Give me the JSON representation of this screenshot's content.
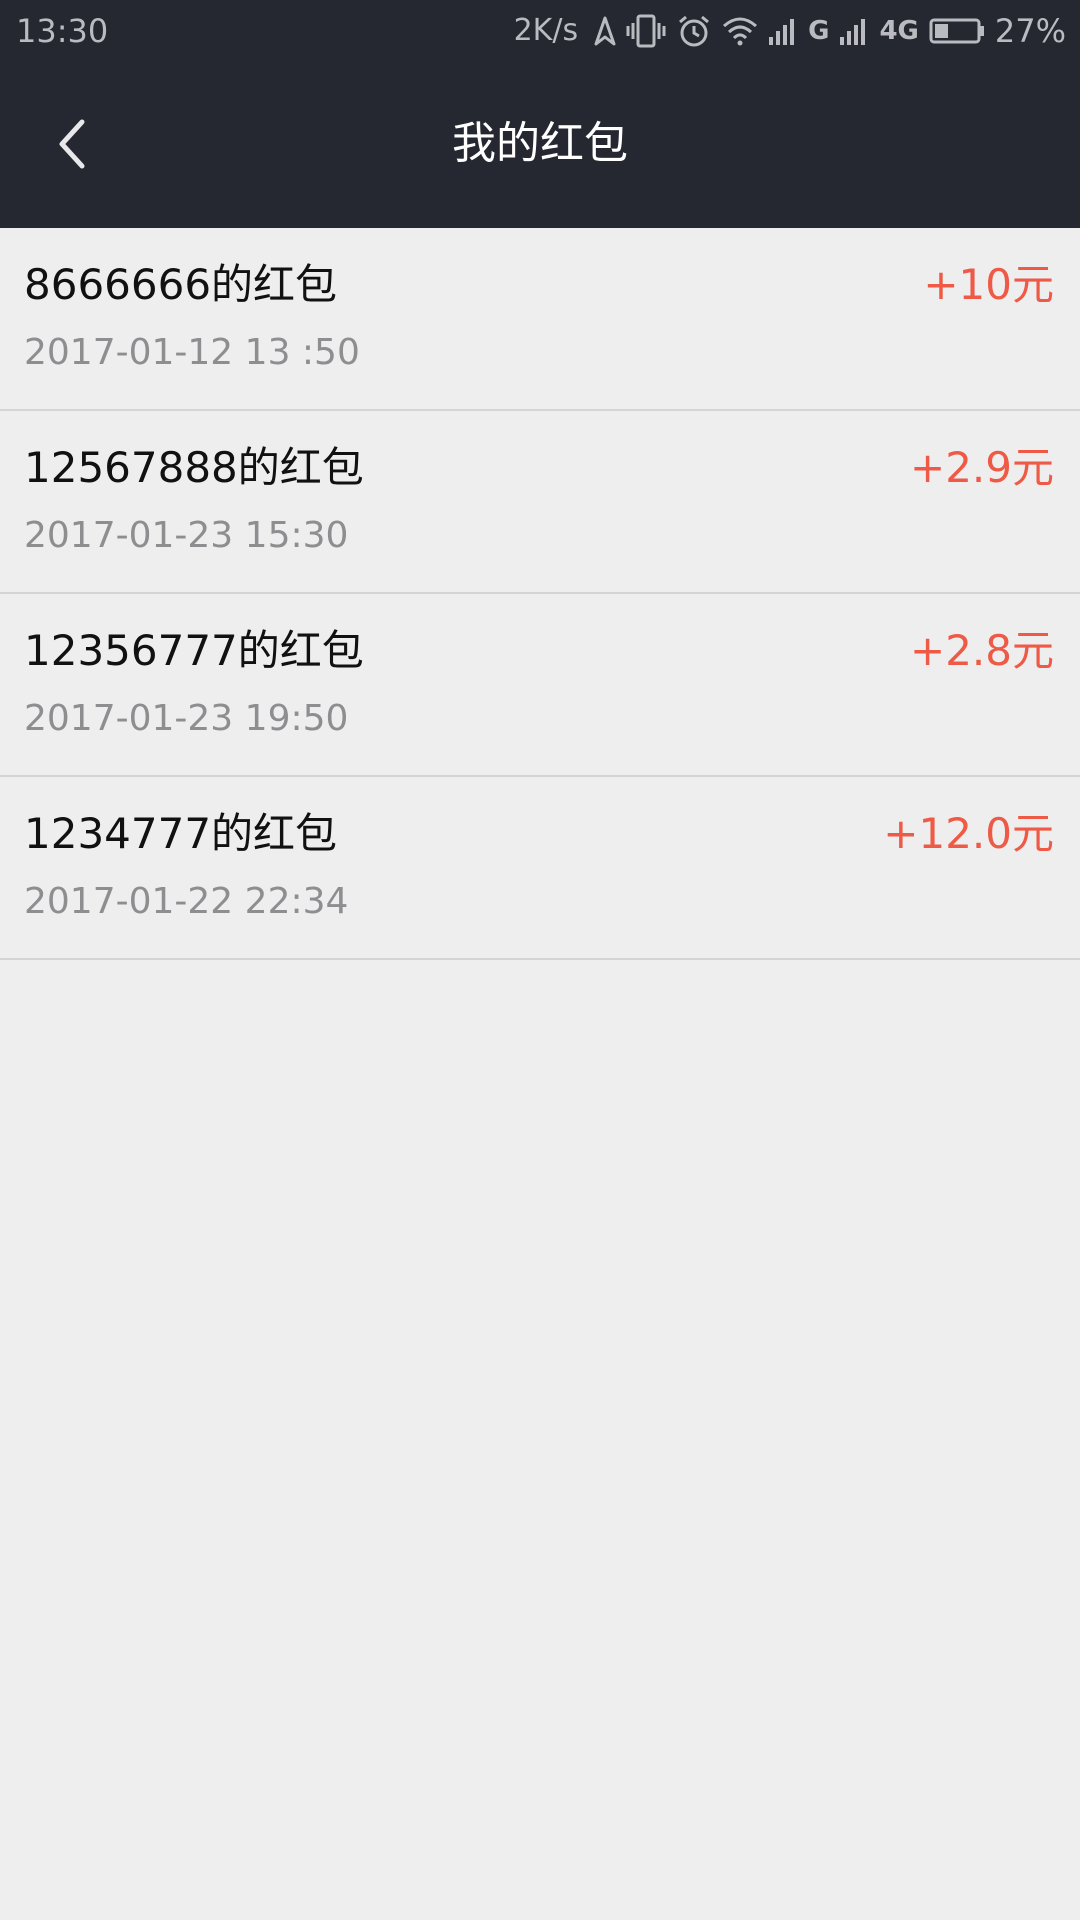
{
  "status_bar": {
    "time": "13:30",
    "net_speed": "2K/s",
    "sim1_label": "G",
    "sim2_label": "4G",
    "battery": "27%",
    "icons": [
      "navigation-icon",
      "vibrate-icon",
      "alarm-icon",
      "wifi-icon",
      "signal-icon",
      "signal-icon",
      "battery-icon"
    ]
  },
  "header": {
    "title": "我的红包",
    "back_icon": "chevron-left-icon"
  },
  "colors": {
    "header_bg": "#252830",
    "page_bg": "#eeeeef",
    "amount": "#ee5a45",
    "secondary_text": "#8e8e91"
  },
  "red_packets": [
    {
      "title": "8666666的红包",
      "time": "2017-01-12 13 :50",
      "amount": "+10元"
    },
    {
      "title": "12567888的红包",
      "time": "2017-01-23 15:30",
      "amount": "+2.9元"
    },
    {
      "title": "12356777的红包",
      "time": "2017-01-23 19:50",
      "amount": "+2.8元"
    },
    {
      "title": "1234777的红包",
      "time": "2017-01-22 22:34",
      "amount": "+12.0元"
    }
  ]
}
